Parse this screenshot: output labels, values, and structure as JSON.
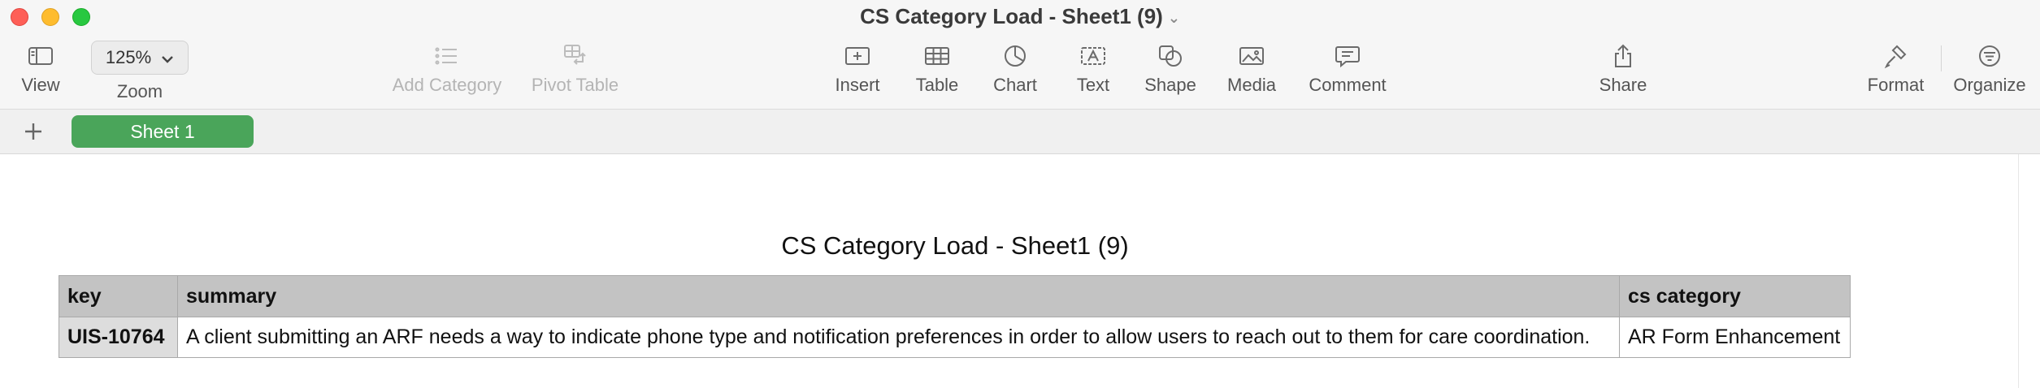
{
  "window": {
    "title": "CS Category Load - Sheet1 (9)"
  },
  "toolbar": {
    "view_label": "View",
    "zoom_value": "125%",
    "zoom_label": "Zoom",
    "add_category_label": "Add Category",
    "pivot_table_label": "Pivot Table",
    "insert_label": "Insert",
    "table_label": "Table",
    "chart_label": "Chart",
    "text_label": "Text",
    "shape_label": "Shape",
    "media_label": "Media",
    "comment_label": "Comment",
    "share_label": "Share",
    "format_label": "Format",
    "organize_label": "Organize"
  },
  "sheets": {
    "active": "Sheet 1"
  },
  "document": {
    "title": "CS Category Load - Sheet1 (9)",
    "table": {
      "headers": [
        "key",
        "summary",
        "cs category"
      ],
      "rows": [
        [
          "UIS-10764",
          "A client submitting an ARF needs a way to indicate phone type and notification preferences in order to allow users to reach out to them for care coordination.",
          "AR Form Enhancement"
        ]
      ]
    }
  },
  "colors": {
    "sheet_tab": "#4aa55a",
    "header_fill": "#c3c3c3",
    "key_fill": "#dddddd"
  }
}
